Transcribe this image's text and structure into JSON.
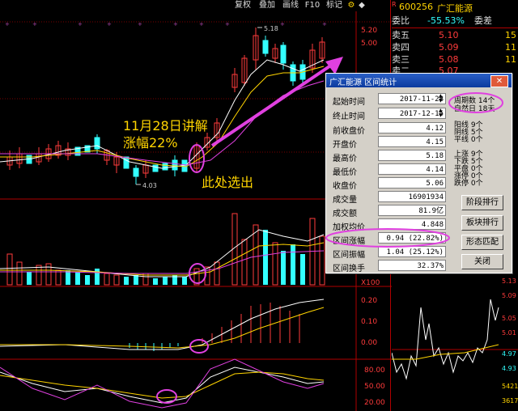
{
  "toolbar": {
    "buttons": [
      "复权",
      "叠加",
      "画线",
      "F10",
      "标记"
    ],
    "icons": [
      "gear-icon",
      "star-icon"
    ]
  },
  "stock": {
    "code": "600256",
    "name": "广汇能源",
    "flag": "R"
  },
  "quote": {
    "weibi_label": "委比",
    "weibi_value": "-55.53%",
    "weicha_label": "委差",
    "asks": [
      {
        "label": "卖五",
        "price": "5.10",
        "vol": "15"
      },
      {
        "label": "卖四",
        "price": "5.09",
        "vol": "11"
      },
      {
        "label": "卖三",
        "price": "5.08",
        "vol": "11"
      },
      {
        "label": "卖二",
        "price": "5.07",
        "vol": ""
      }
    ]
  },
  "chart": {
    "price_axis": [
      "5.20",
      "5.00"
    ],
    "high_label": "5.18",
    "low_label": "4.03",
    "osc_axis": [
      "0.20",
      "0.10",
      "0.00"
    ],
    "kdj_axis": [
      "80.00",
      "50.00",
      "20.00"
    ],
    "vol_axis_label": "X100",
    "right_axis": [
      "5.13",
      "5.09",
      "5.05",
      "5.01",
      "4.97",
      "4.93",
      "5421",
      "3617"
    ]
  },
  "annotations": {
    "lecture_line1": "11月28日讲解",
    "lecture_line2": "涨幅22%",
    "pick_label": "此处选出"
  },
  "dialog": {
    "title": "广汇能源 区间统计",
    "rows": [
      {
        "label": "起始时间",
        "value": "2017-11-28",
        "spin": true
      },
      {
        "label": "终止时间",
        "value": "2017-12-15",
        "spin": true
      },
      {
        "label": "前收盘价",
        "value": "4.12"
      },
      {
        "label": "开盘价",
        "value": "4.15"
      },
      {
        "label": "最高价",
        "value": "5.18"
      },
      {
        "label": "最低价",
        "value": "4.14"
      },
      {
        "label": "收盘价",
        "value": "5.06"
      },
      {
        "label": "成交量",
        "value": "16901934"
      },
      {
        "label": "成交额",
        "value": "81.9亿"
      },
      {
        "label": "加权均价",
        "value": "4.848"
      },
      {
        "label": "区间涨幅",
        "value": "0.94 (22.82%)"
      },
      {
        "label": "区间振幅",
        "value": "1.04 (25.12%)"
      },
      {
        "label": "区间换手",
        "value": "32.37%"
      }
    ],
    "period_label": "周期数",
    "period_value": "14个",
    "natural_label": "自然日",
    "natural_value": "18天",
    "yang_lines": [
      {
        "label": "阳线",
        "value": "9个"
      },
      {
        "label": "阴线",
        "value": "5个"
      },
      {
        "label": "平线",
        "value": "0个"
      }
    ],
    "move_lines": [
      {
        "label": "上涨",
        "value": "9个"
      },
      {
        "label": "下跌",
        "value": "5个"
      },
      {
        "label": "平盘",
        "value": "0个"
      },
      {
        "label": "涨停",
        "value": "0个"
      },
      {
        "label": "跌停",
        "value": "0个"
      }
    ],
    "buttons": [
      "阶段排行",
      "板块排行",
      "形态匹配",
      "关闭"
    ]
  }
}
